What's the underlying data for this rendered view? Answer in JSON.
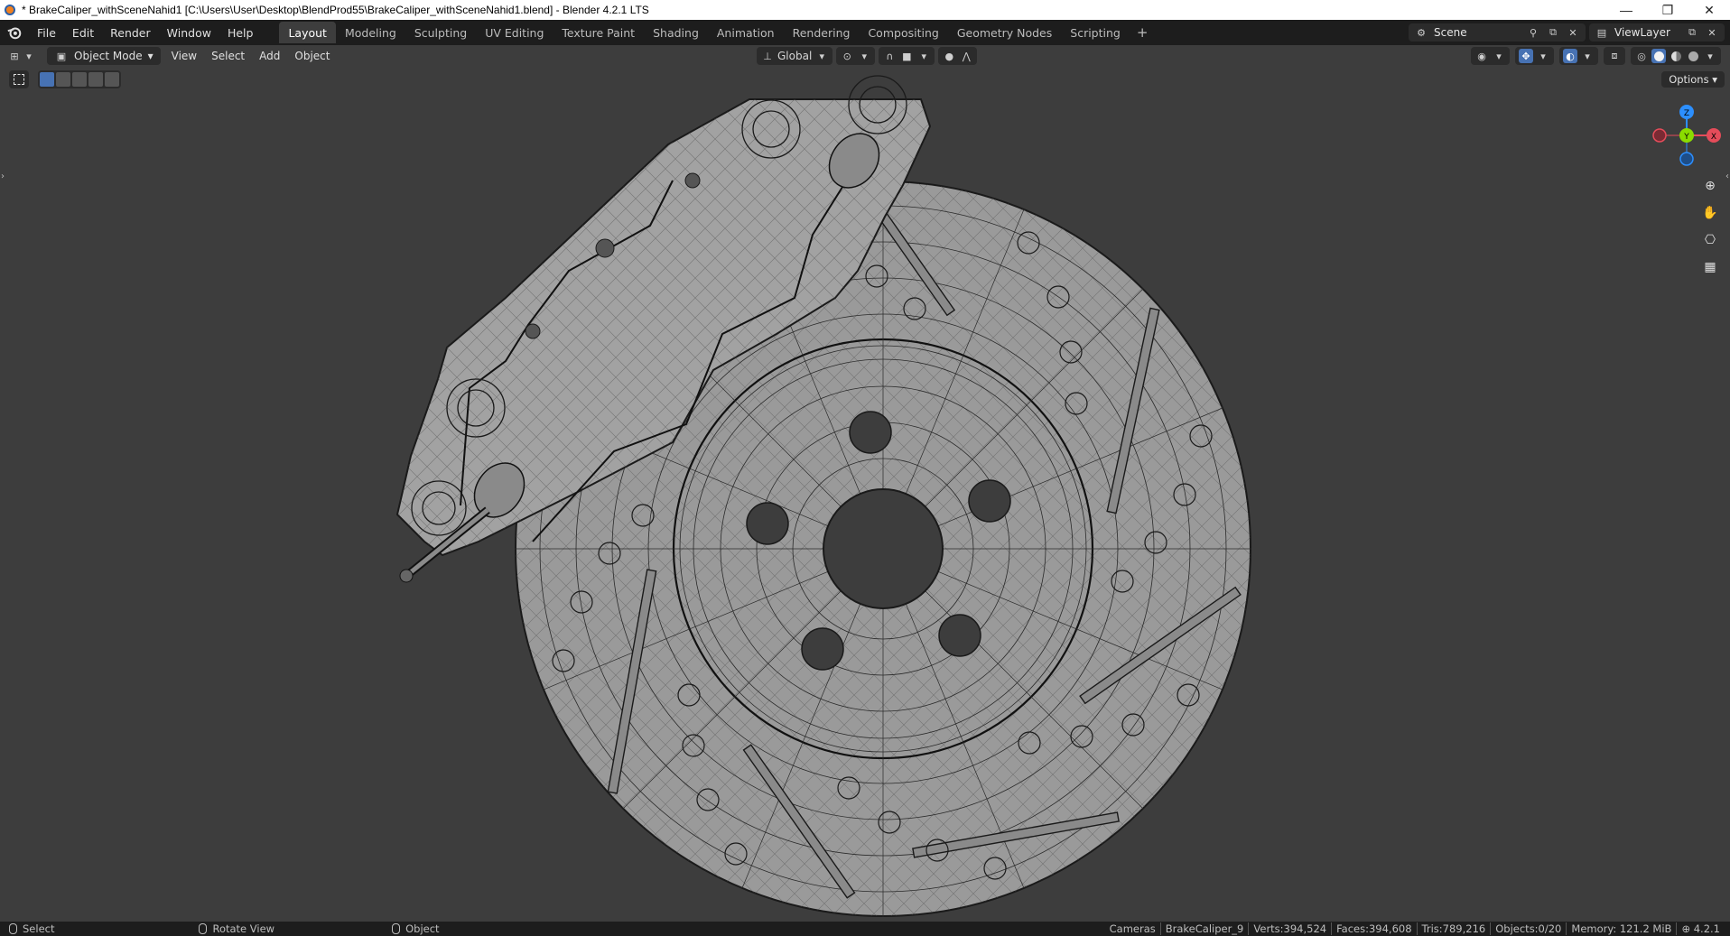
{
  "window": {
    "title": "* BrakeCaliper_withSceneNahid1 [C:\\Users\\User\\Desktop\\BlendProd55\\BrakeCaliper_withSceneNahid1.blend] - Blender 4.2.1 LTS",
    "minimize": "—",
    "maximize": "❐",
    "close": "✕"
  },
  "menu": {
    "items": [
      "File",
      "Edit",
      "Render",
      "Window",
      "Help"
    ]
  },
  "workspaces": {
    "tabs": [
      "Layout",
      "Modeling",
      "Sculpting",
      "UV Editing",
      "Texture Paint",
      "Shading",
      "Animation",
      "Rendering",
      "Compositing",
      "Geometry Nodes",
      "Scripting"
    ],
    "active": "Layout",
    "add": "+"
  },
  "scene": {
    "name": "Scene",
    "view_layer": "ViewLayer"
  },
  "viewport_header": {
    "mode": "Object Mode",
    "menus": [
      "View",
      "Select",
      "Add",
      "Object"
    ],
    "transform_orientation": "Global"
  },
  "tool_settings": {
    "options": "Options"
  },
  "gizmo": {
    "z": "Z",
    "y": "Y",
    "x": "X"
  },
  "status": {
    "select": "Select",
    "rotate": "Rotate View",
    "object": "Object",
    "collection": "Cameras",
    "active_object": "BrakeCaliper_9",
    "verts": "Verts:394,524",
    "faces": "Faces:394,608",
    "tris": "Tris:789,216",
    "objects": "Objects:0/20",
    "memory": "Memory: 121.2 MiB",
    "version": "4.2.1"
  },
  "colors": {
    "accent": "#4772b3",
    "axis_x": "#e54c5a",
    "axis_y": "#8bdc00",
    "axis_z": "#2c8fff",
    "mesh_fill": "#9a9a9a",
    "wire": "#1a1a1a"
  }
}
